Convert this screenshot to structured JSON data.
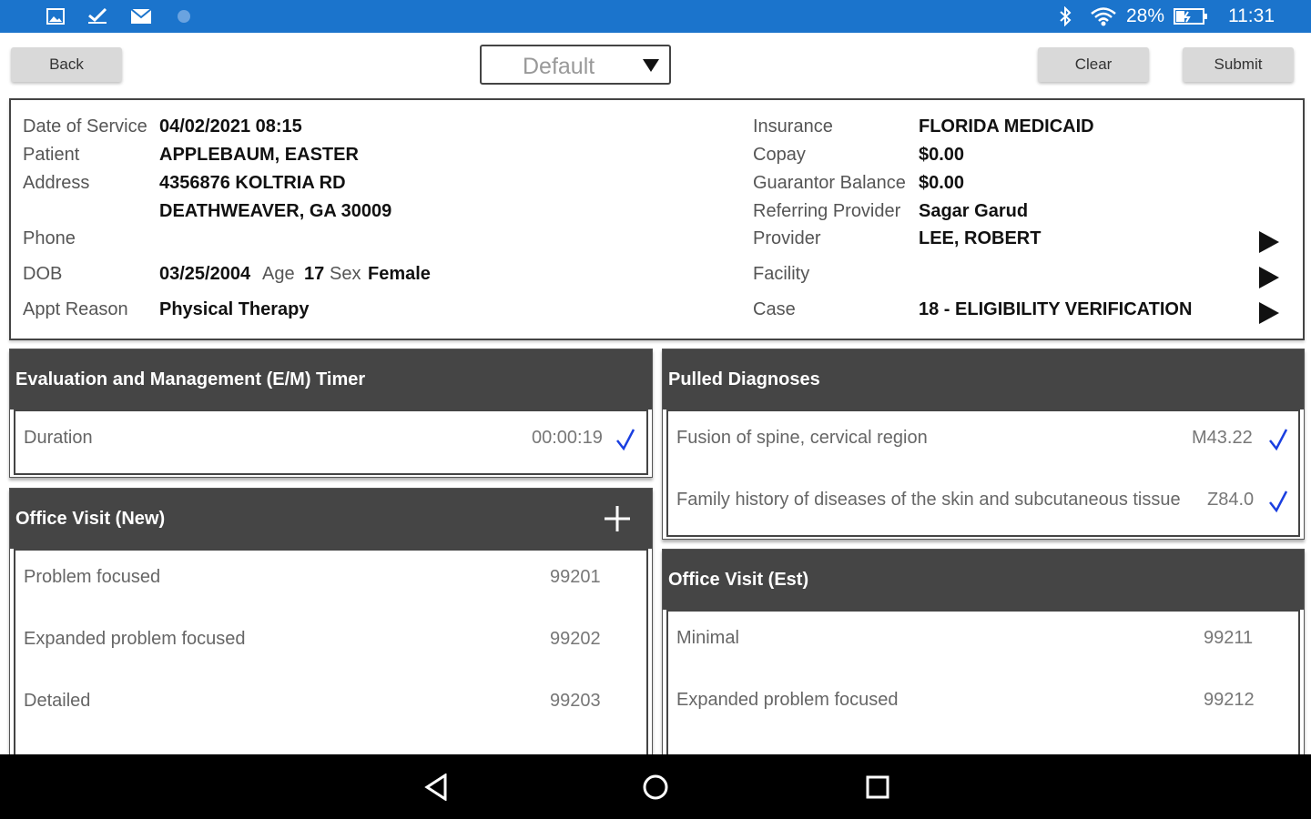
{
  "status_bar": {
    "icons": [
      "image-icon",
      "check-icon",
      "mail-icon",
      "sync-icon"
    ],
    "right_icons": [
      "bluetooth-icon",
      "wifi-icon",
      "battery-icon"
    ],
    "battery": "28%",
    "time": "11:31"
  },
  "toolbar": {
    "back_label": "Back",
    "template_select": "Default",
    "clear_label": "Clear",
    "submit_label": "Submit"
  },
  "patient_info": {
    "date_of_service_label": "Date of Service",
    "date_of_service": "04/02/2021 08:15",
    "patient_label": "Patient",
    "patient": "APPLEBAUM, EASTER",
    "address_label": "Address",
    "address_line1": "4356876 KOLTRIA RD",
    "address_line2": "DEATHWEAVER, GA 30009",
    "phone_label": "Phone",
    "phone": "",
    "dob_label": "DOB",
    "dob": "03/25/2004",
    "age_label": "Age",
    "age": "17",
    "sex_label": "Sex",
    "sex": "Female",
    "appt_reason_label": "Appt Reason",
    "appt_reason": "Physical Therapy",
    "insurance_label": "Insurance",
    "insurance": "FLORIDA MEDICAID",
    "copay_label": "Copay",
    "copay": "$0.00",
    "guarantor_balance_label": "Guarantor Balance",
    "guarantor_balance": "$0.00",
    "referring_provider_label": "Referring Provider",
    "referring_provider": "Sagar Garud",
    "provider_label": "Provider",
    "provider": "LEE, ROBERT",
    "facility_label": "Facility",
    "facility": "",
    "case_label": "Case",
    "case": "18 - ELIGIBILITY VERIFICATION"
  },
  "em_timer": {
    "title": "Evaluation and Management (E/M) Timer",
    "duration_label": "Duration",
    "duration": "00:00:19"
  },
  "pulled_diagnoses": {
    "title": "Pulled Diagnoses",
    "items": [
      {
        "name": "Fusion of spine, cervical region",
        "code": "M43.22"
      },
      {
        "name": "Family history of diseases of the skin and subcutaneous tissue",
        "code": "Z84.0"
      }
    ]
  },
  "office_visit_new": {
    "title": "Office Visit (New)",
    "items": [
      {
        "name": "Problem focused",
        "code": "99201"
      },
      {
        "name": "Expanded problem focused",
        "code": "99202"
      },
      {
        "name": "Detailed",
        "code": "99203"
      }
    ]
  },
  "office_visit_est": {
    "title": "Office Visit (Est)",
    "items": [
      {
        "name": "Minimal",
        "code": "99211"
      },
      {
        "name": "Expanded problem focused",
        "code": "99212"
      }
    ]
  },
  "nav_bar": {
    "buttons": [
      "back-nav-icon",
      "home-nav-icon",
      "recents-nav-icon"
    ]
  },
  "colors": {
    "status_bar": "#1b74cc",
    "section_header": "#454545",
    "check_mark": "#1a3fe0"
  }
}
